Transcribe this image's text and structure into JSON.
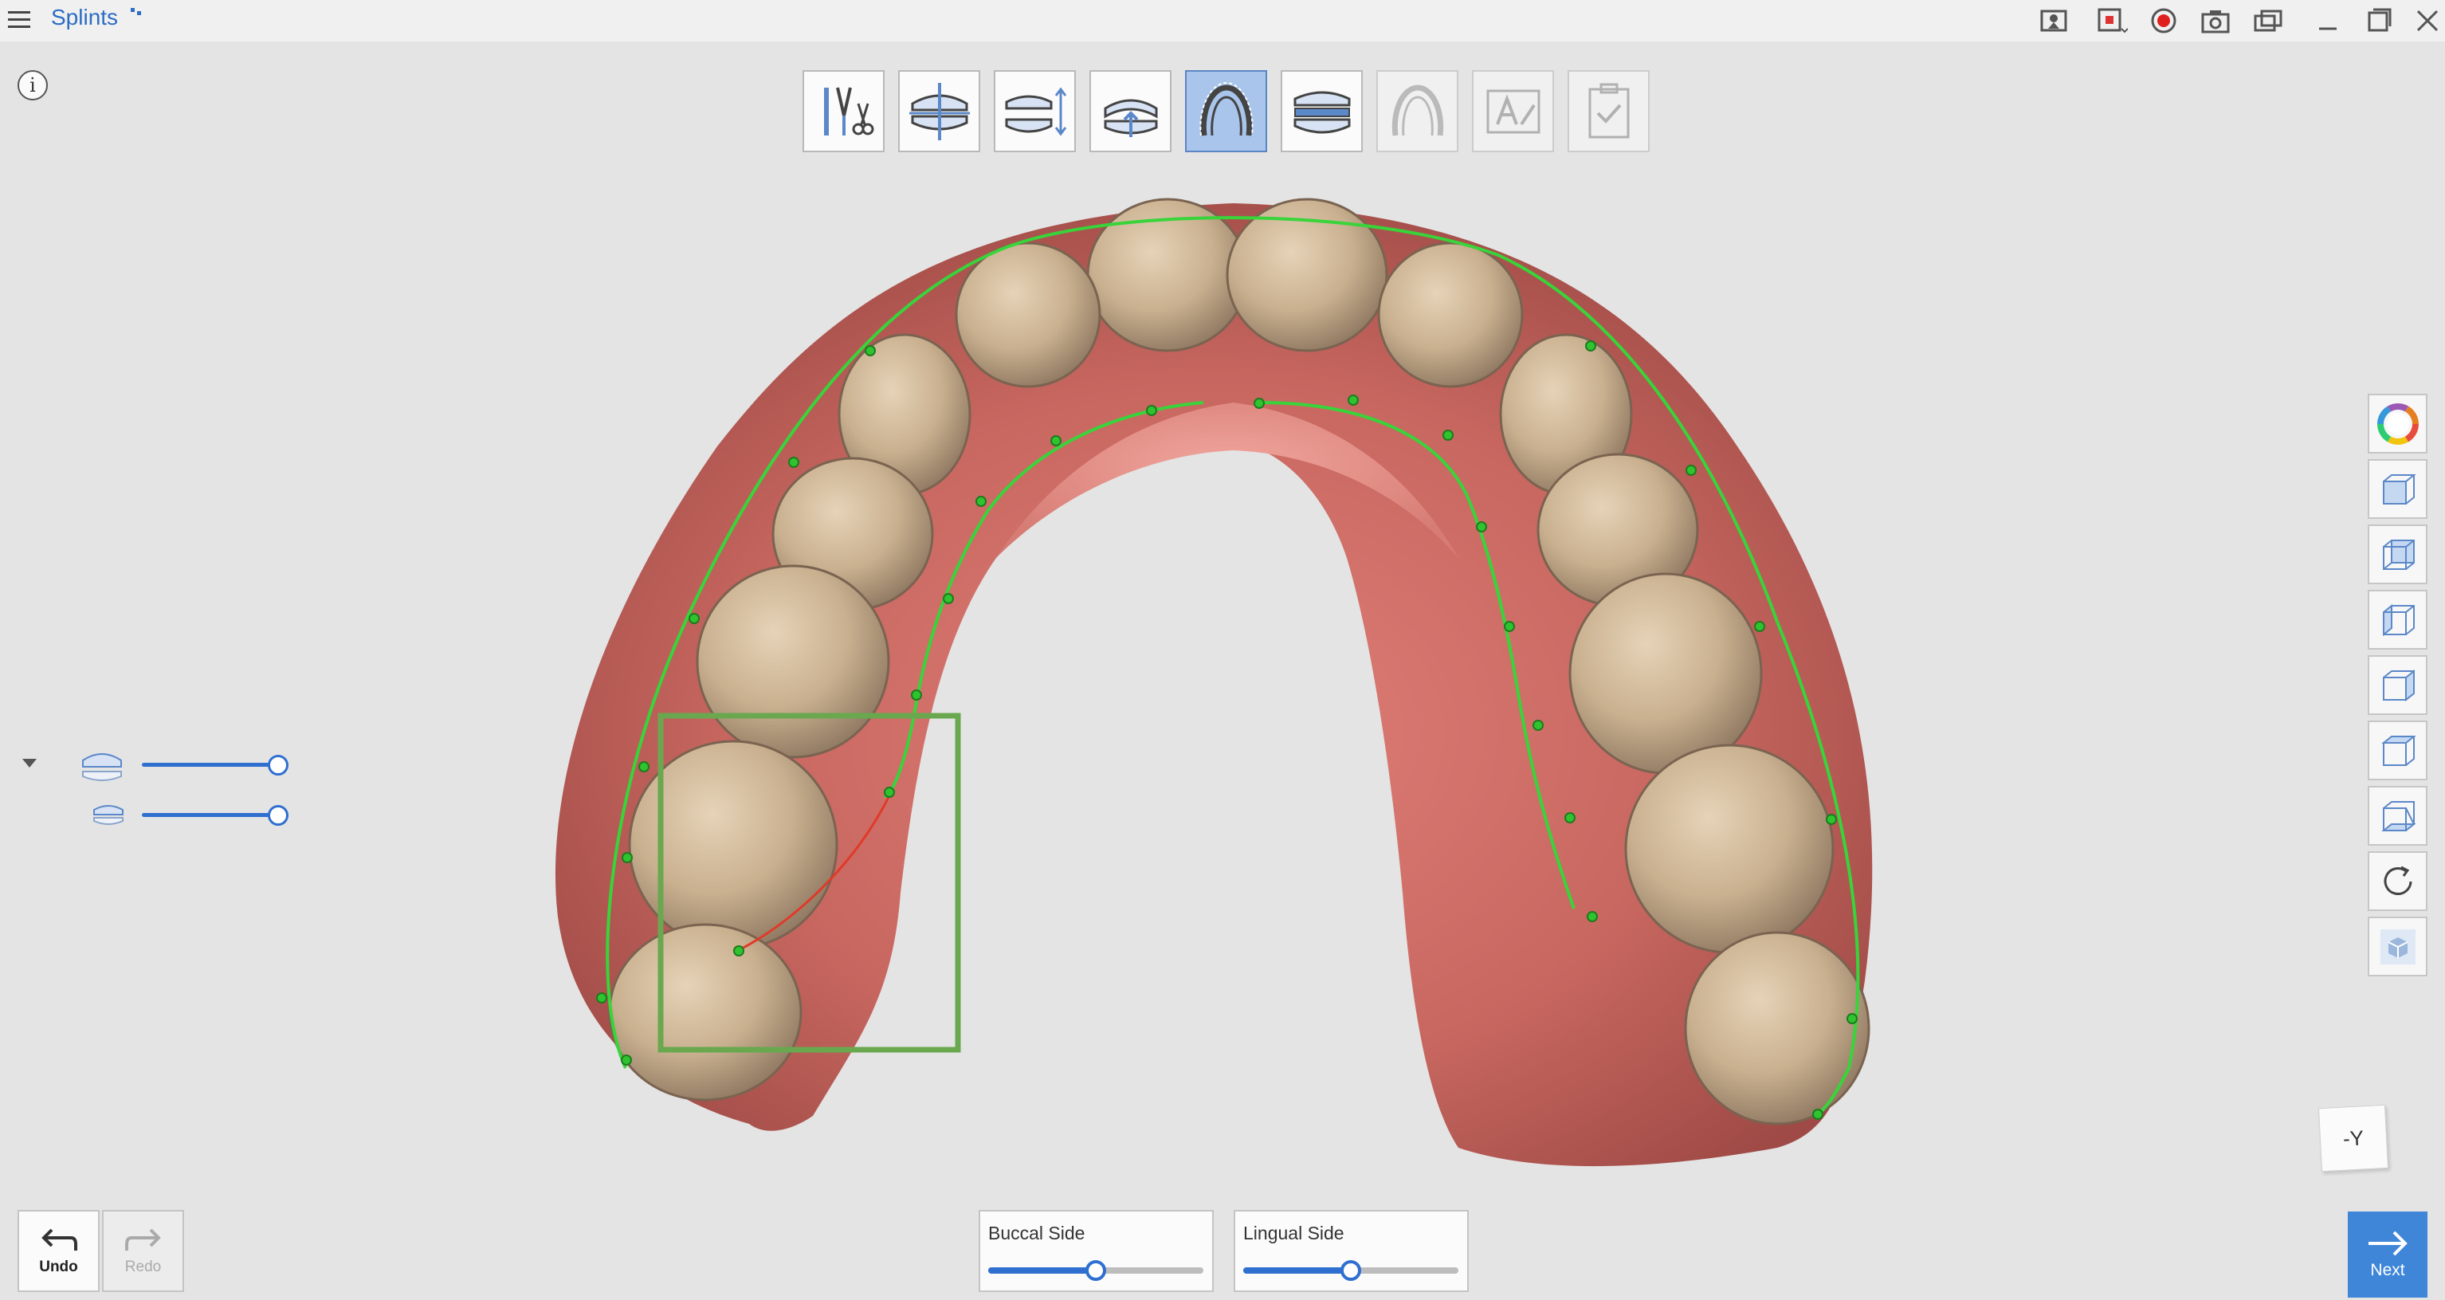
{
  "app": {
    "title": "Splints",
    "title_icon": "pin-icon"
  },
  "titlebar": {
    "icons": [
      "screen-capture-icon",
      "recording-region-icon",
      "record-icon",
      "camera-icon",
      "window-swap-icon",
      "minimize-icon",
      "maximize-icon",
      "close-icon"
    ]
  },
  "toolbar": {
    "tools": [
      {
        "name": "trim-tools",
        "icon": "trim-tools-icon",
        "state": "normal"
      },
      {
        "name": "align-occlusion",
        "icon": "align-occlusion-icon",
        "state": "normal"
      },
      {
        "name": "bite-adjust",
        "icon": "bite-adjust-icon",
        "state": "normal"
      },
      {
        "name": "insertion-direction",
        "icon": "insertion-direction-icon",
        "state": "normal"
      },
      {
        "name": "draw-margin",
        "icon": "draw-margin-icon",
        "state": "active"
      },
      {
        "name": "splint-design",
        "icon": "splint-design-icon",
        "state": "normal"
      },
      {
        "name": "splint-preview",
        "icon": "splint-preview-icon",
        "state": "disabled"
      },
      {
        "name": "text-label",
        "icon": "text-label-icon",
        "state": "disabled"
      },
      {
        "name": "finish",
        "icon": "finish-check-icon",
        "state": "disabled"
      }
    ]
  },
  "info": {
    "label": "i"
  },
  "visibility": {
    "rows": [
      {
        "icon": "upper-jaw-icon",
        "opacity": 1.0
      },
      {
        "icon": "lower-jaw-icon",
        "opacity": 1.0
      }
    ]
  },
  "viewbar": {
    "icons": [
      "color-wheel-icon",
      "front-view-icon",
      "back-view-icon",
      "left-view-icon",
      "right-view-icon",
      "top-view-icon",
      "bottom-view-icon",
      "rotate-view-icon",
      "solid-view-icon"
    ]
  },
  "orientation": {
    "label": "-Y"
  },
  "bottom": {
    "undo_label": "Undo",
    "redo_label": "Redo",
    "buccal": {
      "label": "Buccal Side",
      "value": 0.5
    },
    "lingual": {
      "label": "Lingual Side",
      "value": 0.5
    },
    "next_label": "Next"
  },
  "colors": {
    "accent": "#2f6fd0",
    "active_tool": "#a9c5ec",
    "margin_line": "#38d43a",
    "selection_box": "#6aa84f",
    "next_button": "#3f86d9",
    "gum": "#c9635f",
    "tooth": "#c9b08f"
  }
}
